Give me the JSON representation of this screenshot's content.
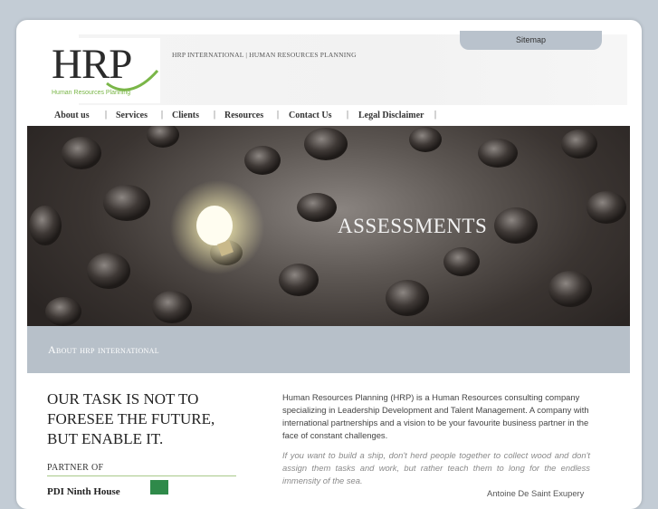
{
  "header": {
    "logo_text": "HRP",
    "logo_tagline": "Human Resources Planning",
    "site_title": "HRP INTERNATIONAL | HUMAN RESOURCES PLANNING",
    "sitemap_label": "Sitemap"
  },
  "nav": {
    "items": [
      {
        "label": "About us"
      },
      {
        "label": "Services"
      },
      {
        "label": "Clients"
      },
      {
        "label": "Resources"
      },
      {
        "label": "Contact Us"
      },
      {
        "label": "Legal Disclaimer"
      }
    ],
    "separator": "|"
  },
  "hero": {
    "title": "ASSESSMENTS"
  },
  "section": {
    "heading": "About hrp international"
  },
  "left_column": {
    "quote": "OUR TASK IS NOT TO FORESEE THE FUTURE, BUT ENABLE IT.",
    "partner_label": "PARTNER OF",
    "partner_name": "PDI Ninth House"
  },
  "right_column": {
    "intro": "Human Resources Planning (HRP) is a Human Resources consulting company specializing in Leadership Development and Talent Management. A company with international partnerships and a vision to be your favourite business partner in the face of constant challenges.",
    "quote": "If you want to build a ship, don't herd people together to collect wood and don't assign them tasks and work, but rather teach them to long for the endless immensity of the sea.",
    "quote_author": "Antoine De Saint Exupery"
  },
  "colors": {
    "background": "#c3ccd5",
    "accent_green": "#7ab648",
    "about_bar": "#b7c0c9"
  }
}
